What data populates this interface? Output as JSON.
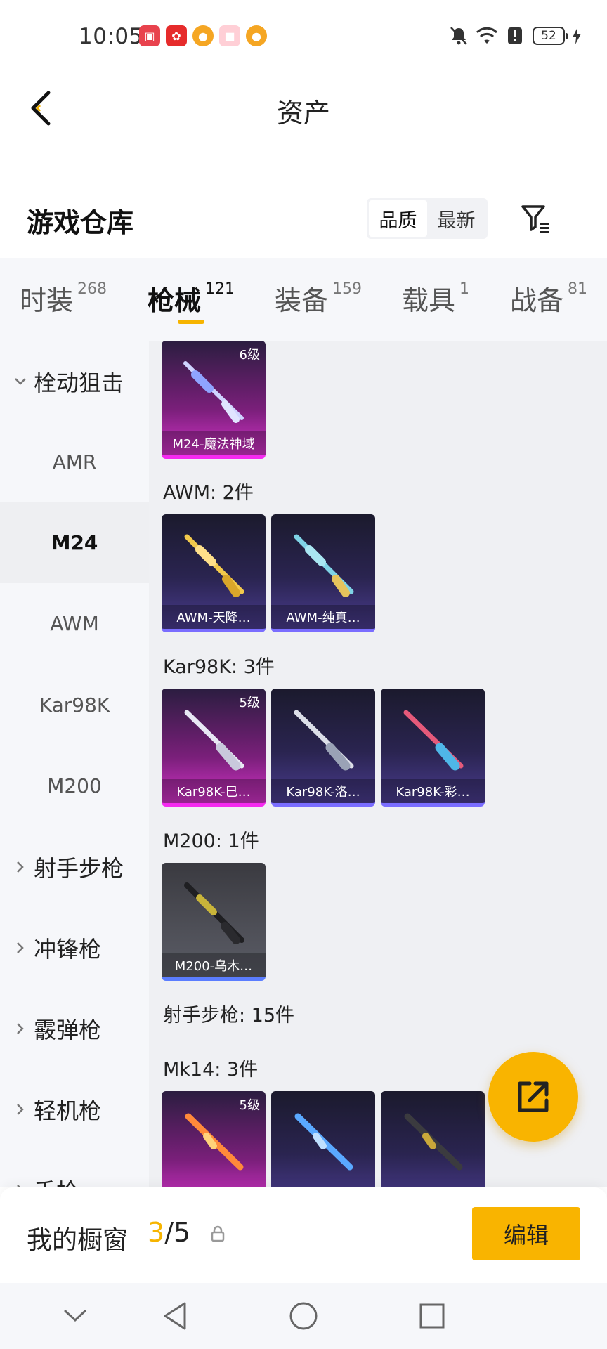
{
  "status_bar": {
    "time": "10:05",
    "battery": "52",
    "icons": [
      "mute-bell-icon",
      "wifi-icon",
      "alert-icon",
      "battery-icon",
      "charging-icon"
    ]
  },
  "header": {
    "title": "资产",
    "back_icon": "chevron-left-icon"
  },
  "warehouse": {
    "title": "游戏仓库",
    "sort_options": [
      "品质",
      "最新"
    ],
    "selected_sort": "品质",
    "filter_icon": "filter-icon"
  },
  "tabs": [
    {
      "label": "时装",
      "count": "268"
    },
    {
      "label": "枪械",
      "count": "121"
    },
    {
      "label": "装备",
      "count": "159"
    },
    {
      "label": "载具",
      "count": "1"
    },
    {
      "label": "战备",
      "count": "81"
    }
  ],
  "active_tab": "枪械",
  "sidebar": {
    "items": [
      {
        "label": "栓动狙击",
        "type": "group",
        "expanded": true
      },
      {
        "label": "AMR",
        "type": "sub"
      },
      {
        "label": "M24",
        "type": "sub",
        "selected": true
      },
      {
        "label": "AWM",
        "type": "sub"
      },
      {
        "label": "Kar98K",
        "type": "sub"
      },
      {
        "label": "M200",
        "type": "sub"
      },
      {
        "label": "射手步枪",
        "type": "group"
      },
      {
        "label": "冲锋枪",
        "type": "group"
      },
      {
        "label": "霰弹枪",
        "type": "group"
      },
      {
        "label": "轻机枪",
        "type": "group"
      },
      {
        "label": "手枪",
        "type": "group"
      }
    ]
  },
  "content": {
    "m24_items": [
      {
        "name": "M24-魔法神域",
        "level": "6级",
        "rarity": "purple"
      }
    ],
    "awm_heading": "AWM: 2件",
    "awm_items": [
      {
        "name": "AWM-天降…",
        "rarity": "blue"
      },
      {
        "name": "AWM-纯真…",
        "rarity": "blue"
      }
    ],
    "kar_heading": "Kar98K: 3件",
    "kar_items": [
      {
        "name": "Kar98K-巳…",
        "level": "5级",
        "rarity": "purple"
      },
      {
        "name": "Kar98K-洛…",
        "rarity": "blue"
      },
      {
        "name": "Kar98K-彩…",
        "rarity": "blue"
      }
    ],
    "m200_heading": "M200: 1件",
    "m200_items": [
      {
        "name": "M200-乌木…",
        "rarity": "gray"
      }
    ],
    "marksman_heading": "射手步枪: 15件",
    "mk14_heading": "Mk14: 3件",
    "mk14_items": [
      {
        "level": "5级",
        "rarity": "purple"
      },
      {
        "rarity": "blue"
      },
      {
        "rarity": "blue"
      }
    ]
  },
  "fab": {
    "icon": "share-external-icon"
  },
  "showcase": {
    "label": "我的橱窗",
    "current": "3",
    "total": "/5",
    "lock_icon": "lock-icon",
    "edit_label": "编辑"
  },
  "system_nav": [
    "back-nav-icon",
    "home-nav-icon",
    "recent-apps-icon",
    "collapse-chevron-icon"
  ],
  "colors": {
    "accent": "#f9b400",
    "purple_rarity": "#f52af0",
    "blue_rarity": "#7a6dff"
  }
}
